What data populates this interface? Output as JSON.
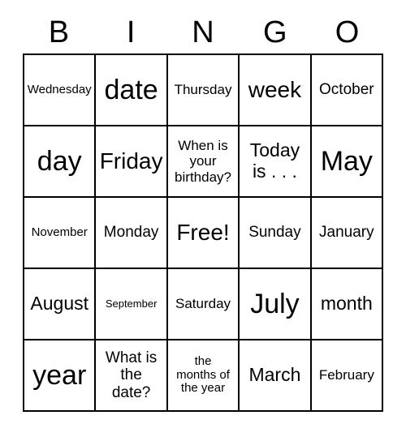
{
  "card": {
    "header": {
      "letters": [
        "B",
        "I",
        "N",
        "G",
        "O"
      ]
    },
    "rows": [
      [
        {
          "text": "Wednesday",
          "size": "fs-s"
        },
        {
          "text": "date",
          "size": "fs-xxl"
        },
        {
          "text": "Thursday",
          "size": "fs-m"
        },
        {
          "text": "week",
          "size": "fs-xl"
        },
        {
          "text": "October",
          "size": "fs-ml"
        }
      ],
      [
        {
          "text": "day",
          "size": "fs-xxl"
        },
        {
          "text": "Friday",
          "size": "fs-xl"
        },
        {
          "text": "When is\nyour\nbirthday?",
          "size": "fs-m"
        },
        {
          "text": "Today\nis . . .",
          "size": "fs-l"
        },
        {
          "text": "May",
          "size": "fs-xxl"
        }
      ],
      [
        {
          "text": "November",
          "size": "fs-s"
        },
        {
          "text": "Monday",
          "size": "fs-ml"
        },
        {
          "text": "Free!",
          "size": "fs-xl"
        },
        {
          "text": "Sunday",
          "size": "fs-ml"
        },
        {
          "text": "January",
          "size": "fs-ml"
        }
      ],
      [
        {
          "text": "August",
          "size": "fs-l"
        },
        {
          "text": "September",
          "size": "fs-xs"
        },
        {
          "text": "Saturday",
          "size": "fs-m"
        },
        {
          "text": "July",
          "size": "fs-xxl"
        },
        {
          "text": "month",
          "size": "fs-l"
        }
      ],
      [
        {
          "text": "year",
          "size": "fs-xxl"
        },
        {
          "text": "What is\nthe\ndate?",
          "size": "fs-ml"
        },
        {
          "text": "the\nmonths of\nthe year",
          "size": "fs-s"
        },
        {
          "text": "March",
          "size": "fs-l"
        },
        {
          "text": "February",
          "size": "fs-m"
        }
      ]
    ]
  },
  "colors": {
    "border": "#000000",
    "background": "#ffffff",
    "text": "#000000"
  }
}
